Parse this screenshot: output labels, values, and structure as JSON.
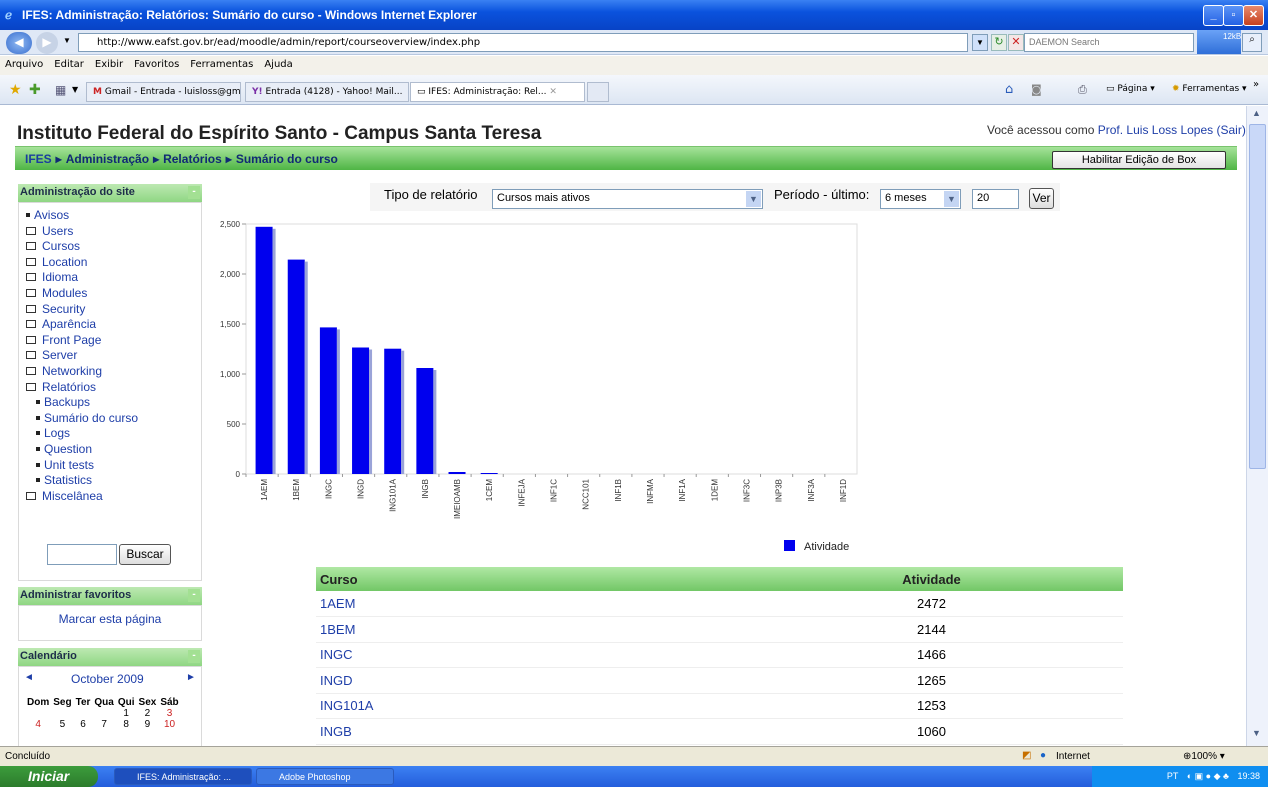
{
  "window": {
    "title": "IFES: Administração: Relatórios: Sumário do curso - Windows Internet Explorer",
    "url": "http://www.eafst.gov.br/ead/moodle/admin/report/courseoverview/index.php",
    "search_placeholder": "DAEMON Search",
    "net_badge": "12kB"
  },
  "menu": [
    "Arquivo",
    "Editar",
    "Exibir",
    "Favoritos",
    "Ferramentas",
    "Ajuda"
  ],
  "tabs": [
    {
      "label": "Gmail - Entrada - luisloss@gm..."
    },
    {
      "label": "Entrada (4128) - Yahoo! Mail..."
    },
    {
      "label": "IFES: Administração: Rel..."
    }
  ],
  "toolbar_right": {
    "page": "Página",
    "tools": "Ferramentas"
  },
  "site": {
    "title": "Instituto Federal do Espírito Santo - Campus Santa Teresa",
    "login_prefix": "Você acessou como",
    "user": "Prof. Luis Loss Lopes",
    "logout": "(Sair)"
  },
  "breadcrumb": [
    "IFES",
    "Administração",
    "Relatórios",
    "Sumário do curso"
  ],
  "edit_button": "Habilitar Edição de Box",
  "admin_block": {
    "title": "Administração do site",
    "items": [
      {
        "label": "Avisos",
        "kind": "bullet"
      },
      {
        "label": "Users",
        "kind": "folder"
      },
      {
        "label": "Cursos",
        "kind": "folder"
      },
      {
        "label": "Location",
        "kind": "folder"
      },
      {
        "label": "Idioma",
        "kind": "folder"
      },
      {
        "label": "Modules",
        "kind": "folder"
      },
      {
        "label": "Security",
        "kind": "folder"
      },
      {
        "label": "Aparência",
        "kind": "folder"
      },
      {
        "label": "Front Page",
        "kind": "folder"
      },
      {
        "label": "Server",
        "kind": "folder"
      },
      {
        "label": "Networking",
        "kind": "folder"
      },
      {
        "label": "Relatórios",
        "kind": "open-folder"
      },
      {
        "label": "Backups",
        "kind": "sub"
      },
      {
        "label": "Sumário do curso",
        "kind": "sub"
      },
      {
        "label": "Logs",
        "kind": "sub"
      },
      {
        "label": "Question",
        "kind": "sub"
      },
      {
        "label": "Unit tests",
        "kind": "sub"
      },
      {
        "label": "Statistics",
        "kind": "sub"
      },
      {
        "label": "Miscelânea",
        "kind": "folder"
      }
    ],
    "search_button": "Buscar"
  },
  "fav_block": {
    "title": "Administrar favoritos",
    "link": "Marcar esta página"
  },
  "calendar": {
    "title": "Calendário",
    "month": "October 2009",
    "days": [
      "Dom",
      "Seg",
      "Ter",
      "Qua",
      "Qui",
      "Sex",
      "Sáb"
    ],
    "rows": [
      [
        "",
        "",
        "",
        "",
        "1",
        "2",
        "3"
      ],
      [
        "4",
        "5",
        "6",
        "7",
        "8",
        "9",
        "10"
      ]
    ]
  },
  "controls": {
    "report_label": "Tipo de relatório",
    "report_value": "Cursos mais ativos",
    "period_label": "Período - último:",
    "period_value": "6 meses",
    "count_value": "20",
    "go": "Ver"
  },
  "chart_data": {
    "type": "bar",
    "categories": [
      "1AEM",
      "1BEM",
      "INGC",
      "INGD",
      "ING101A",
      "INGB",
      "IMEIOAMB",
      "1CEM",
      "INFEJA",
      "INF1C",
      "NCC101",
      "INF1B",
      "INFMA",
      "INF1A",
      "1DEM",
      "INF3C",
      "INP3B",
      "INF3A",
      "INF1D"
    ],
    "series": [
      {
        "name": "Atividade",
        "values": [
          2472,
          2144,
          1466,
          1265,
          1253,
          1060,
          20,
          10,
          0,
          0,
          0,
          0,
          0,
          0,
          0,
          0,
          0,
          0,
          0
        ]
      }
    ],
    "ylim": [
      0,
      2500
    ],
    "yticks": [
      "0",
      "500",
      "1,000",
      "1,500",
      "2,000",
      "2,500"
    ],
    "legend": "bottom-right",
    "color": "#0000ee"
  },
  "table": {
    "headers": [
      "Curso",
      "Atividade"
    ],
    "rows": [
      [
        "1AEM",
        "2472"
      ],
      [
        "1BEM",
        "2144"
      ],
      [
        "INGC",
        "1466"
      ],
      [
        "INGD",
        "1265"
      ],
      [
        "ING101A",
        "1253"
      ],
      [
        "INGB",
        "1060"
      ]
    ]
  },
  "statusbar": {
    "left": "Concluído",
    "zone": "Internet",
    "zoom": "100%"
  },
  "taskbar": {
    "start": "Iniciar",
    "items": [
      "IFES: Administração: ...",
      "Adobe Photoshop"
    ],
    "lang": "PT",
    "clock": "19:38"
  }
}
